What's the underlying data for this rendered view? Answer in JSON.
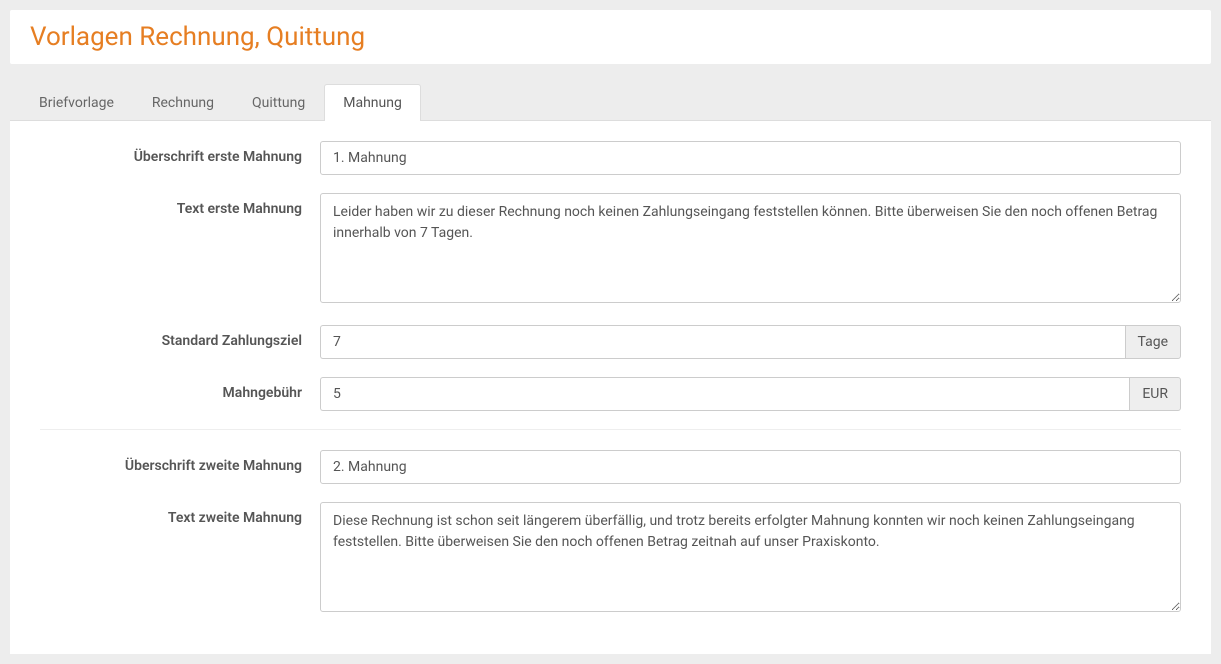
{
  "header": {
    "title": "Vorlagen Rechnung, Quittung"
  },
  "tabs": [
    {
      "label": "Briefvorlage"
    },
    {
      "label": "Rechnung"
    },
    {
      "label": "Quittung"
    },
    {
      "label": "Mahnung"
    }
  ],
  "form": {
    "heading1": {
      "label": "Überschrift erste Mahnung",
      "value": "1. Mahnung"
    },
    "text1": {
      "label": "Text erste Mahnung",
      "value": "Leider haben wir zu dieser Rechnung noch keinen Zahlungseingang feststellen können. Bitte überweisen Sie den noch offenen Betrag innerhalb von 7 Tagen."
    },
    "payment_target": {
      "label": "Standard Zahlungsziel",
      "value": "7",
      "unit": "Tage"
    },
    "fee": {
      "label": "Mahngebühr",
      "value": "5",
      "unit": "EUR"
    },
    "heading2": {
      "label": "Überschrift zweite Mahnung",
      "value": "2. Mahnung"
    },
    "text2": {
      "label": "Text zweite Mahnung",
      "value": "Diese Rechnung ist schon seit längerem überfällig, und trotz bereits erfolgter Mahnung konnten wir noch keinen Zahlungseingang feststellen. Bitte überweisen Sie den noch offenen Betrag zeitnah auf unser Praxiskonto."
    }
  }
}
